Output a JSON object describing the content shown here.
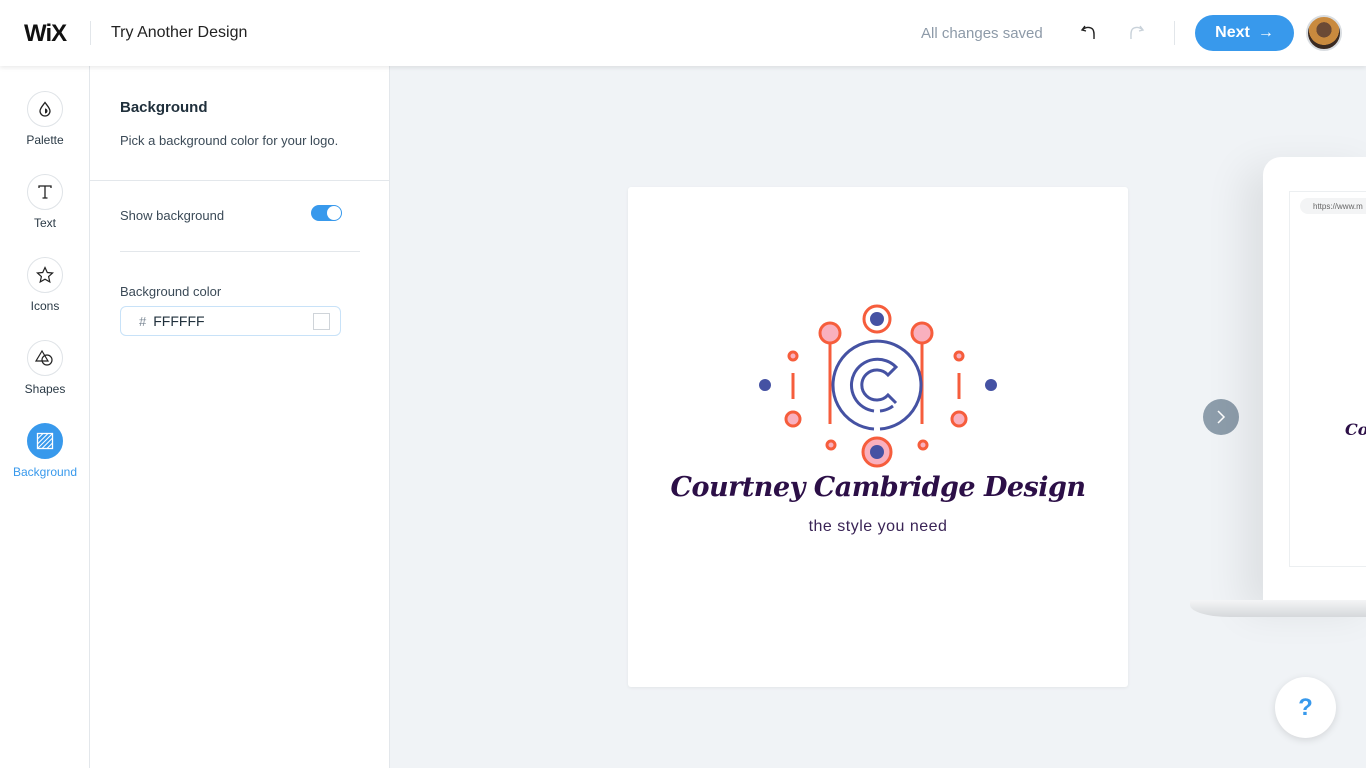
{
  "header": {
    "logo": "WiX",
    "title": "Try Another Design",
    "status": "All changes saved",
    "next_label": "Next",
    "next_icon": "arrow-right-icon"
  },
  "rail": {
    "items": [
      {
        "label": "Palette",
        "icon": "drop-icon"
      },
      {
        "label": "Text",
        "icon": "text-icon"
      },
      {
        "label": "Icons",
        "icon": "star-icon"
      },
      {
        "label": "Shapes",
        "icon": "shapes-icon"
      },
      {
        "label": "Background",
        "icon": "background-icon",
        "active": true
      }
    ]
  },
  "panel": {
    "title": "Background",
    "description": "Pick a background color for your logo.",
    "show_background_label": "Show background",
    "show_background": true,
    "color_label": "Background color",
    "hash": "#",
    "color_value": "FFFFFF"
  },
  "logo": {
    "brand": "Courtney Cambridge Design",
    "tagline": "the style you need",
    "colors": {
      "orange": "#f65d3c",
      "pink": "#f9b0be",
      "blue": "#4552a3",
      "text": "#2c0f47"
    }
  },
  "preview": {
    "url": "https://www.m",
    "mini_brand": "Cou"
  },
  "help": {
    "label": "?"
  },
  "colors": {
    "accent": "#3899ec"
  }
}
